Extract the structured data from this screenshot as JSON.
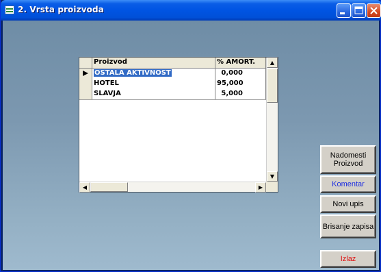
{
  "window": {
    "title": "2. Vrsta proizvoda"
  },
  "grid": {
    "columns": [
      "Proizvod",
      "% AMORT."
    ],
    "rows": [
      {
        "name": "OSTALA AKTIVNOST",
        "value": "0,000",
        "selected": true
      },
      {
        "name": "HOTEL",
        "value": "95,000",
        "selected": false
      },
      {
        "name": "SLAVJA",
        "value": "5,000",
        "selected": false
      }
    ]
  },
  "buttons": {
    "replace": "Nadomesti Proizvod",
    "comment": "Komentar",
    "new": "Novi upis",
    "delete": "Brisanje zapisa",
    "exit": "Izlaz"
  },
  "colors": {
    "comment_text": "#1f2fe0",
    "exit_text": "#e01010",
    "selection": "#316ac5",
    "titlebar": "#0054e3"
  }
}
